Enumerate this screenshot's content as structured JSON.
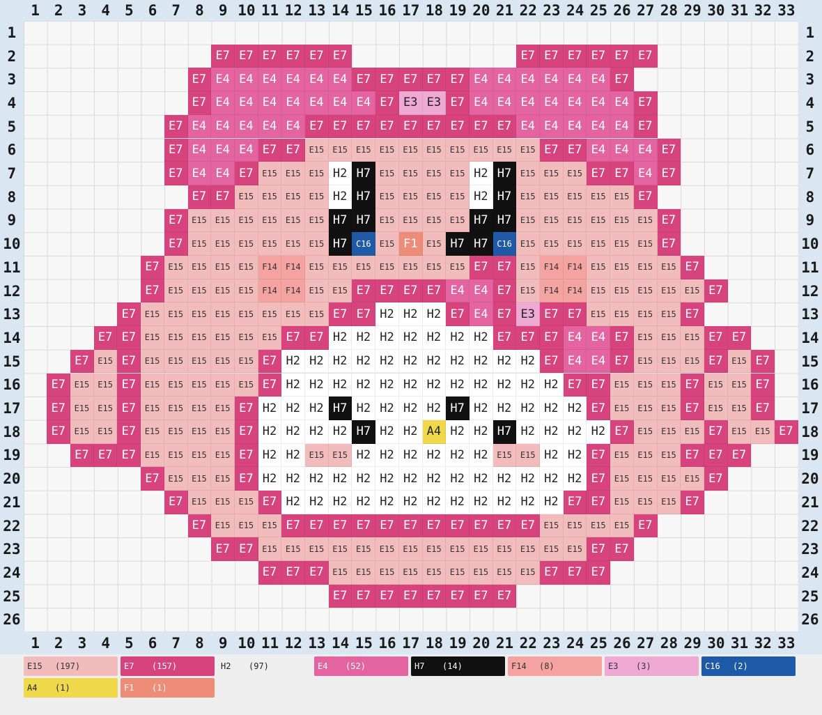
{
  "grid": {
    "cols": 33,
    "rows": 26,
    "col_labels": [
      "1",
      "2",
      "3",
      "4",
      "5",
      "6",
      "7",
      "8",
      "9",
      "10",
      "11",
      "12",
      "13",
      "14",
      "15",
      "16",
      "17",
      "18",
      "19",
      "20",
      "21",
      "22",
      "23",
      "24",
      "25",
      "26",
      "27",
      "28",
      "29",
      "30",
      "31",
      "32",
      "33"
    ],
    "row_labels": [
      "1",
      "2",
      "3",
      "4",
      "5",
      "6",
      "7",
      "8",
      "9",
      "10",
      "11",
      "12",
      "13",
      "14",
      "15",
      "16",
      "17",
      "18",
      "19",
      "20",
      "21",
      "22",
      "23",
      "24",
      "25",
      "26"
    ],
    "pattern": [
      ".................................",
      "........aaaaaa.......aaaaaa......",
      ".......abbbbbbaaaaabbbbbba.......",
      ".......abbbbbbbaiiabbbbbbba......",
      "......abbbbbaaaaaaaaabbbbba......",
      "......abbbaaccccccccccaabbba.....",
      "......abbacccdeccccdecccaaba.....",
      ".......aaccccdeccccdeccccca......",
      "......acccccceecccceecccccca.....",
      "......accccccefcgceefcccccca.....",
      ".....acccchhcccccccaachhcccca....",
      ".....acccchhccaaaabbachhccccca...",
      "....accccccccaadddabaiaacccca....",
      "...aaccccccaadddddddaaabbacccaa..",
      "..acacccccadddddddddddabbacccaca.",
      ".accacccccaddddddddddddaacccacca.",
      ".accaccccadddeddddedddddacccacca.",
      ".accaccccaddddeddjddeddddacccacca",
      "..aaaccccaddccddddddccddacccaaa..",
      ".....acccaddddddddddddddacccca...",
      "......acccaddddddddddddaaccca....",
      ".......acccaaaaaaaaaaacccca......",
      "........aaccccccccccccccaa.......",
      "..........aaacccccccccaaa........",
      ".............aaaaaaaa............",
      "................................."
    ],
    "legend_key": {
      "a": "E7",
      "b": "E4",
      "c": "E15",
      "d": "H2",
      "e": "H7",
      "f": "C16",
      "g": "F1",
      "h": "F14",
      "i": "E3",
      "j": "A4"
    },
    "colors": {
      "E7": "#d6437d",
      "E4": "#e364a0",
      "E15": "#f2bcbc",
      "H2": "#ffffff",
      "H7": "#111111",
      "C16": "#1f5aa8",
      "F1": "#ee8d77",
      "F14": "#f4a3a0",
      "E3": "#eeaad4",
      "A4": "#efd94a"
    },
    "text_colors": {
      "E7": "#ffffff",
      "E4": "#ffffff",
      "E15": "#333333",
      "H2": "#222222",
      "H7": "#ffffff",
      "C16": "#ffffff",
      "F1": "#ffffff",
      "F14": "#333333",
      "E3": "#222222",
      "A4": "#222222"
    }
  },
  "legend": [
    {
      "code": "E15",
      "count": "(197)",
      "color": "#f2bcbc",
      "text_color": "#333333"
    },
    {
      "code": "E7",
      "count": "(157)",
      "color": "#d6437d",
      "text_color": "#ffffff"
    },
    {
      "code": "H2",
      "count": "(97)",
      "color": "#eeeeee",
      "text_color": "#222222"
    },
    {
      "code": "E4",
      "count": "(52)",
      "color": "#e364a0",
      "text_color": "#ffffff"
    },
    {
      "code": "H7",
      "count": "(14)",
      "color": "#111111",
      "text_color": "#ffffff"
    },
    {
      "code": "F14",
      "count": "(8)",
      "color": "#f4a3a0",
      "text_color": "#333333"
    },
    {
      "code": "E3",
      "count": "(3)",
      "color": "#eeaad4",
      "text_color": "#333333"
    },
    {
      "code": "C16",
      "count": "(2)",
      "color": "#1f5aa8",
      "text_color": "#ffffff"
    },
    {
      "code": "A4",
      "count": "(1)",
      "color": "#efd94a",
      "text_color": "#222222"
    },
    {
      "code": "F1",
      "count": "(1)",
      "color": "#ee8d77",
      "text_color": "#ffffff"
    }
  ]
}
